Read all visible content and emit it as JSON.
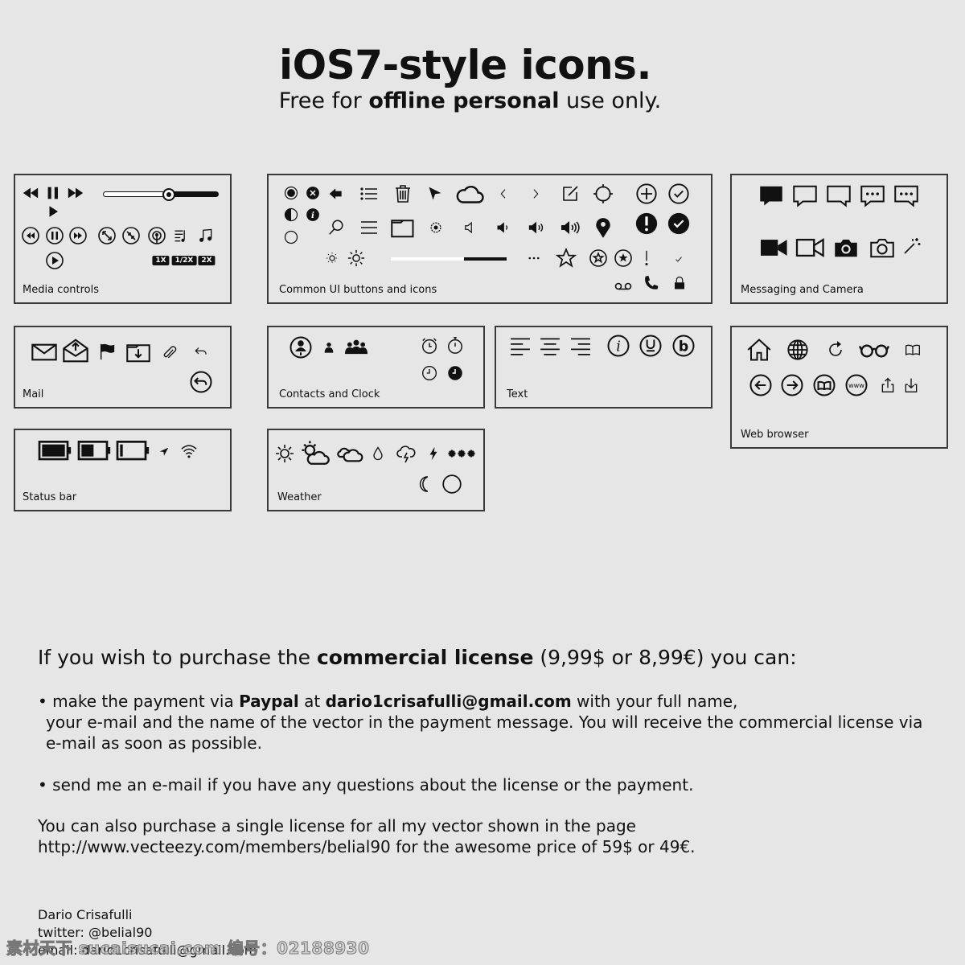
{
  "header": {
    "title": "iOS7-style icons.",
    "subtitle_pre": "Free for ",
    "subtitle_bold": "offline personal",
    "subtitle_post": " use only."
  },
  "panels": {
    "media": {
      "label": "Media controls",
      "badges": [
        "1X",
        "1/2X",
        "2X"
      ],
      "slider_value": 0.57,
      "icons": [
        "rewind-icon",
        "pause-icon",
        "fast-forward-icon",
        "play-icon",
        "rewind-circle-icon",
        "pause-circle-icon",
        "fast-forward-circle-icon",
        "expand-icon",
        "collapse-icon",
        "podcast-icon",
        "playlist-icon",
        "music-note-icon",
        "play-circle-icon"
      ]
    },
    "common": {
      "label": "Common UI buttons and icons",
      "slider_value": 0.63,
      "icons": [
        "radio-selected-icon",
        "close-circle-icon",
        "back-arrow-icon",
        "list-icon",
        "trash-icon",
        "location-arrow-icon",
        "cloud-icon",
        "chevron-left-icon",
        "chevron-right-icon",
        "compose-icon",
        "compass-icon",
        "plus-circle-icon",
        "check-circle-icon",
        "contrast-icon",
        "info-icon",
        "search-icon",
        "menu-icon",
        "folder-icon",
        "gear-icon",
        "speaker-mute-icon",
        "speaker-low-icon",
        "speaker-mid-icon",
        "speaker-high-icon",
        "map-pin-icon",
        "alert-circle-icon",
        "check-circle-filled-icon",
        "radio-empty-icon",
        "brightness-low-icon",
        "brightness-high-icon",
        "ellipsis-icon",
        "star-icon",
        "star-circle-icon",
        "star-circle-filled-icon",
        "exclamation-icon",
        "check-icon",
        "voicemail-icon",
        "phone-icon",
        "lock-icon"
      ]
    },
    "messaging": {
      "label": "Messaging and Camera",
      "icons": [
        "chat-filled-icon",
        "chat-icon",
        "chat-right-icon",
        "chat-typing-icon",
        "chat-typing-right-icon",
        "video-filled-icon",
        "video-icon",
        "camera-filled-icon",
        "camera-icon",
        "magic-wand-icon"
      ]
    },
    "mail": {
      "label": "Mail",
      "icons": [
        "envelope-icon",
        "envelope-open-icon",
        "flag-icon",
        "move-to-folder-icon",
        "attachment-icon",
        "reply-icon",
        "reply-circle-icon"
      ]
    },
    "contacts": {
      "label": "Contacts and Clock",
      "icons": [
        "contact-circle-icon",
        "person-icon",
        "group-icon",
        "alarm-icon",
        "stopwatch-icon",
        "clock-icon",
        "clock-filled-icon"
      ]
    },
    "text": {
      "label": "Text",
      "icons": [
        "align-left-icon",
        "align-center-icon",
        "align-right-icon",
        "italic-icon",
        "underline-icon",
        "bold-icon"
      ]
    },
    "web": {
      "label": "Web browser",
      "icons": [
        "home-icon",
        "globe-icon",
        "refresh-icon",
        "reading-glasses-icon",
        "book-icon",
        "back-circle-icon",
        "forward-circle-icon",
        "bookmarks-circle-icon",
        "www-icon",
        "share-icon",
        "download-icon"
      ]
    },
    "status": {
      "label": "Status bar",
      "icons": [
        "battery-full-icon",
        "battery-half-icon",
        "battery-low-icon",
        "location-services-icon",
        "wifi-icon"
      ]
    },
    "weather": {
      "label": "Weather",
      "icons": [
        "sun-icon",
        "partly-cloudy-icon",
        "cloudy-icon",
        "rain-drop-icon",
        "thunderstorm-icon",
        "lightning-icon",
        "snow-icon",
        "moon-icon",
        "full-moon-icon"
      ]
    }
  },
  "license": {
    "lead_pre": "If you wish to purchase the ",
    "lead_bold": "commercial license",
    "lead_post": " (9,99$ or 8,99€) you can:",
    "b1_pre": "• make the payment via ",
    "b1_bold1": "Paypal",
    "b1_mid": " at ",
    "b1_bold2": "dario1crisafulli@gmail.com",
    "b1_post": " with your full name,",
    "b1_line2": "your e-mail and the name of the vector in the payment message. You will receive the commercial license via",
    "b1_line3": "e-mail as soon as possible.",
    "b2": "• send me an e-mail if you have any questions about the license or the payment.",
    "p1": "You can also purchase a single license for all my vector shown in the page",
    "p2": "http://www.vecteezy.com/members/belial90 for the awesome price of 59$ or 49€."
  },
  "footer": {
    "name": "Dario Crisafulli",
    "twitter": "twitter: @belial90",
    "email": "email:  dario1crisafulli@gmail.com"
  },
  "watermark": "素材天下 sucaisucai.com  编号：02188930"
}
